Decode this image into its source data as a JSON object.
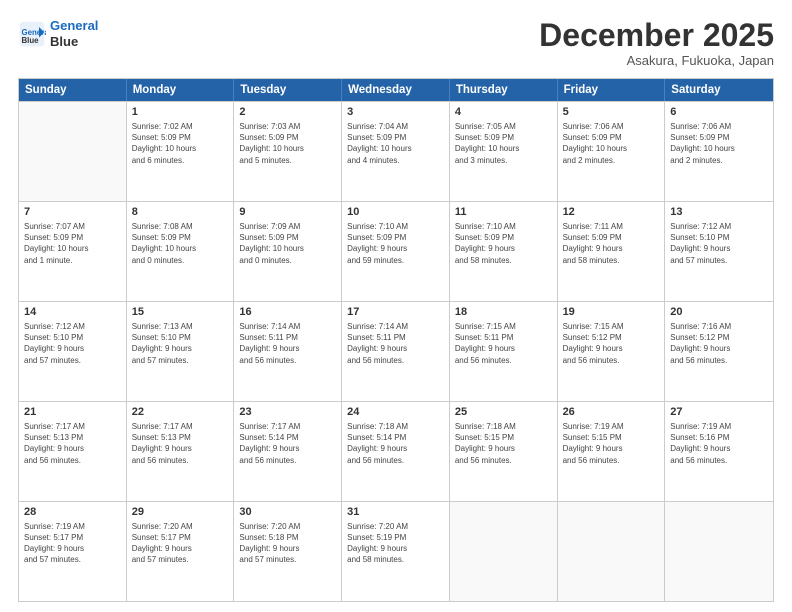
{
  "header": {
    "logo_line1": "General",
    "logo_line2": "Blue",
    "month": "December 2025",
    "location": "Asakura, Fukuoka, Japan"
  },
  "days_of_week": [
    "Sunday",
    "Monday",
    "Tuesday",
    "Wednesday",
    "Thursday",
    "Friday",
    "Saturday"
  ],
  "weeks": [
    [
      {
        "day": "",
        "info": ""
      },
      {
        "day": "1",
        "info": "Sunrise: 7:02 AM\nSunset: 5:09 PM\nDaylight: 10 hours\nand 6 minutes."
      },
      {
        "day": "2",
        "info": "Sunrise: 7:03 AM\nSunset: 5:09 PM\nDaylight: 10 hours\nand 5 minutes."
      },
      {
        "day": "3",
        "info": "Sunrise: 7:04 AM\nSunset: 5:09 PM\nDaylight: 10 hours\nand 4 minutes."
      },
      {
        "day": "4",
        "info": "Sunrise: 7:05 AM\nSunset: 5:09 PM\nDaylight: 10 hours\nand 3 minutes."
      },
      {
        "day": "5",
        "info": "Sunrise: 7:06 AM\nSunset: 5:09 PM\nDaylight: 10 hours\nand 2 minutes."
      },
      {
        "day": "6",
        "info": "Sunrise: 7:06 AM\nSunset: 5:09 PM\nDaylight: 10 hours\nand 2 minutes."
      }
    ],
    [
      {
        "day": "7",
        "info": "Sunrise: 7:07 AM\nSunset: 5:09 PM\nDaylight: 10 hours\nand 1 minute."
      },
      {
        "day": "8",
        "info": "Sunrise: 7:08 AM\nSunset: 5:09 PM\nDaylight: 10 hours\nand 0 minutes."
      },
      {
        "day": "9",
        "info": "Sunrise: 7:09 AM\nSunset: 5:09 PM\nDaylight: 10 hours\nand 0 minutes."
      },
      {
        "day": "10",
        "info": "Sunrise: 7:10 AM\nSunset: 5:09 PM\nDaylight: 9 hours\nand 59 minutes."
      },
      {
        "day": "11",
        "info": "Sunrise: 7:10 AM\nSunset: 5:09 PM\nDaylight: 9 hours\nand 58 minutes."
      },
      {
        "day": "12",
        "info": "Sunrise: 7:11 AM\nSunset: 5:09 PM\nDaylight: 9 hours\nand 58 minutes."
      },
      {
        "day": "13",
        "info": "Sunrise: 7:12 AM\nSunset: 5:10 PM\nDaylight: 9 hours\nand 57 minutes."
      }
    ],
    [
      {
        "day": "14",
        "info": "Sunrise: 7:12 AM\nSunset: 5:10 PM\nDaylight: 9 hours\nand 57 minutes."
      },
      {
        "day": "15",
        "info": "Sunrise: 7:13 AM\nSunset: 5:10 PM\nDaylight: 9 hours\nand 57 minutes."
      },
      {
        "day": "16",
        "info": "Sunrise: 7:14 AM\nSunset: 5:11 PM\nDaylight: 9 hours\nand 56 minutes."
      },
      {
        "day": "17",
        "info": "Sunrise: 7:14 AM\nSunset: 5:11 PM\nDaylight: 9 hours\nand 56 minutes."
      },
      {
        "day": "18",
        "info": "Sunrise: 7:15 AM\nSunset: 5:11 PM\nDaylight: 9 hours\nand 56 minutes."
      },
      {
        "day": "19",
        "info": "Sunrise: 7:15 AM\nSunset: 5:12 PM\nDaylight: 9 hours\nand 56 minutes."
      },
      {
        "day": "20",
        "info": "Sunrise: 7:16 AM\nSunset: 5:12 PM\nDaylight: 9 hours\nand 56 minutes."
      }
    ],
    [
      {
        "day": "21",
        "info": "Sunrise: 7:17 AM\nSunset: 5:13 PM\nDaylight: 9 hours\nand 56 minutes."
      },
      {
        "day": "22",
        "info": "Sunrise: 7:17 AM\nSunset: 5:13 PM\nDaylight: 9 hours\nand 56 minutes."
      },
      {
        "day": "23",
        "info": "Sunrise: 7:17 AM\nSunset: 5:14 PM\nDaylight: 9 hours\nand 56 minutes."
      },
      {
        "day": "24",
        "info": "Sunrise: 7:18 AM\nSunset: 5:14 PM\nDaylight: 9 hours\nand 56 minutes."
      },
      {
        "day": "25",
        "info": "Sunrise: 7:18 AM\nSunset: 5:15 PM\nDaylight: 9 hours\nand 56 minutes."
      },
      {
        "day": "26",
        "info": "Sunrise: 7:19 AM\nSunset: 5:15 PM\nDaylight: 9 hours\nand 56 minutes."
      },
      {
        "day": "27",
        "info": "Sunrise: 7:19 AM\nSunset: 5:16 PM\nDaylight: 9 hours\nand 56 minutes."
      }
    ],
    [
      {
        "day": "28",
        "info": "Sunrise: 7:19 AM\nSunset: 5:17 PM\nDaylight: 9 hours\nand 57 minutes."
      },
      {
        "day": "29",
        "info": "Sunrise: 7:20 AM\nSunset: 5:17 PM\nDaylight: 9 hours\nand 57 minutes."
      },
      {
        "day": "30",
        "info": "Sunrise: 7:20 AM\nSunset: 5:18 PM\nDaylight: 9 hours\nand 57 minutes."
      },
      {
        "day": "31",
        "info": "Sunrise: 7:20 AM\nSunset: 5:19 PM\nDaylight: 9 hours\nand 58 minutes."
      },
      {
        "day": "",
        "info": ""
      },
      {
        "day": "",
        "info": ""
      },
      {
        "day": "",
        "info": ""
      }
    ]
  ]
}
